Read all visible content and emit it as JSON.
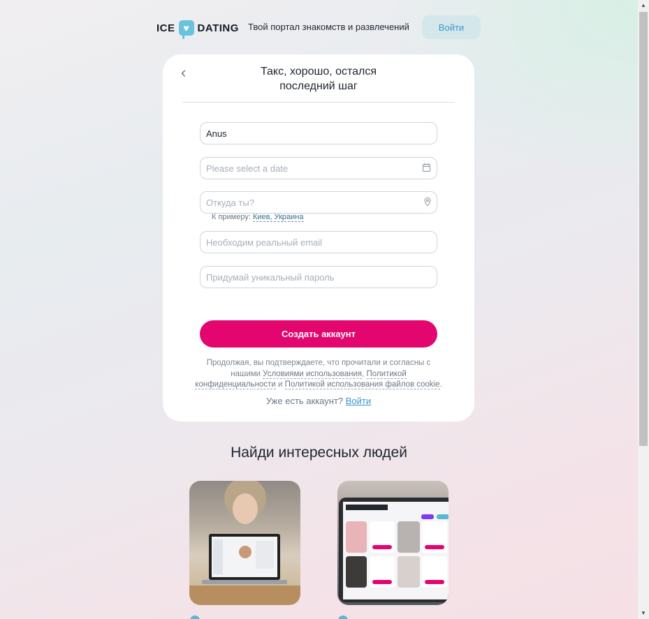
{
  "header": {
    "logo_left": "ICE",
    "logo_right": "DATING",
    "logo_symbol": "♥",
    "tagline": "Твой портал знакомств и развлечений",
    "login_label": "Войти"
  },
  "card": {
    "back_glyph": "‹",
    "title_line1": "Такс, хорошо, остался",
    "title_line2": "последний шаг",
    "name_value": "Anus",
    "date_placeholder": "Please select a date",
    "city_placeholder": "Откуда ты?",
    "hint_prefix": "К примеру: ",
    "hint_example": "Киев, Украина",
    "email_placeholder": "Необходим реальный email",
    "password_placeholder": "Придумай уникальный пароль",
    "create_label": "Создать аккаунт",
    "terms_prefix": "Продолжая, вы подтверждаете, что прочитали и согласны с нашими ",
    "terms_link": "Условиями использования",
    "terms_sep1": ", ",
    "privacy_link": "Политикой конфиденциальности",
    "terms_and": " и ",
    "cookie_link": "Политикой использования файлов cookie",
    "terms_end": ".",
    "have_account": "Уже есть аккаунт? ",
    "login_link": "Войти"
  },
  "section": {
    "title": "Найди интересных людей"
  },
  "icons": {
    "calendar": "calendar-icon",
    "location": "location-pin-icon"
  }
}
